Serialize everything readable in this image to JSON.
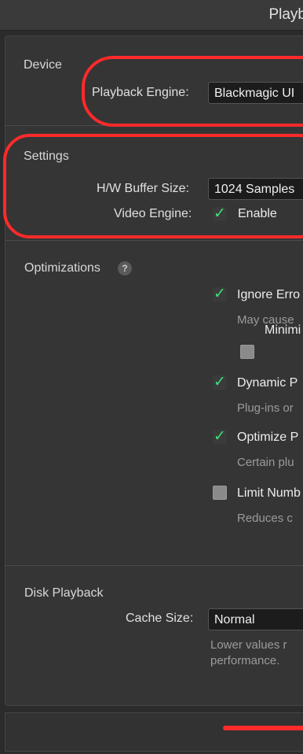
{
  "window": {
    "title": "Playb"
  },
  "device": {
    "section_label": "Device",
    "playback_engine_label": "Playback Engine:",
    "playback_engine_value": "Blackmagic UI"
  },
  "settings": {
    "section_label": "Settings",
    "buffer_size_label": "H/W Buffer Size:",
    "buffer_size_value": "1024 Samples",
    "video_engine_label": "Video Engine:",
    "video_engine_checkbox_label": "Enable",
    "video_engine_checked": true
  },
  "optimizations": {
    "section_label": "Optimizations",
    "help_label": "?",
    "options": [
      {
        "label": "Ignore Erro",
        "desc": "May cause",
        "checked": true
      },
      {
        "label": "Minimi",
        "desc": "",
        "checked": false
      },
      {
        "label": "Dynamic P",
        "desc": "Plug-ins or",
        "checked": true
      },
      {
        "label": "Optimize P",
        "desc": "Certain plu",
        "checked": true
      },
      {
        "label": "Limit Numb",
        "desc": "Reduces c",
        "checked": false
      }
    ]
  },
  "disk_playback": {
    "section_label": "Disk Playback",
    "cache_size_label": "Cache Size:",
    "cache_size_value": "Normal",
    "desc_line1": "Lower values r",
    "desc_line2": "performance."
  },
  "colors": {
    "check_green": "#3ee07a",
    "highlight_red": "#ff2a2a",
    "panel_bg": "#353535"
  }
}
